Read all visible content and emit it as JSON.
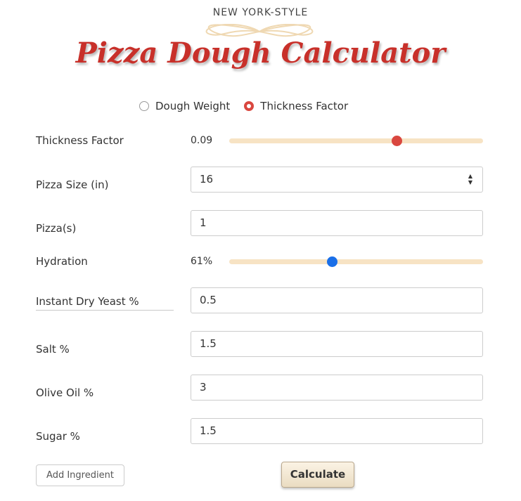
{
  "header": {
    "subtitle": "NEW YORK-STYLE",
    "title": "Pizza Dough Calculator"
  },
  "mode": {
    "options": [
      {
        "label": "Dough Weight",
        "selected": false
      },
      {
        "label": "Thickness Factor",
        "selected": true
      }
    ]
  },
  "fields": {
    "thickness_factor": {
      "label": "Thickness Factor",
      "value": "0.09",
      "slider_fraction": 0.66,
      "thumb_color": "#d9473f"
    },
    "pizza_size": {
      "label": "Pizza Size (in)",
      "value": "16"
    },
    "pizzas": {
      "label": "Pizza(s)",
      "value": "1"
    },
    "hydration": {
      "label": "Hydration",
      "value": "61%",
      "slider_fraction": 0.405,
      "thumb_color": "#1a6fe8"
    },
    "yeast": {
      "label": "Instant Dry Yeast %",
      "value": "0.5"
    },
    "salt": {
      "label": "Salt %",
      "value": "1.5"
    },
    "olive_oil": {
      "label": "Olive Oil %",
      "value": "3"
    },
    "sugar": {
      "label": "Sugar %",
      "value": "1.5"
    }
  },
  "actions": {
    "add_ingredient": "Add Ingredient",
    "calculate": "Calculate"
  },
  "colors": {
    "title": "#c8302a",
    "slider_track": "#f7e3c4",
    "radio_selected": "#d9473f"
  }
}
